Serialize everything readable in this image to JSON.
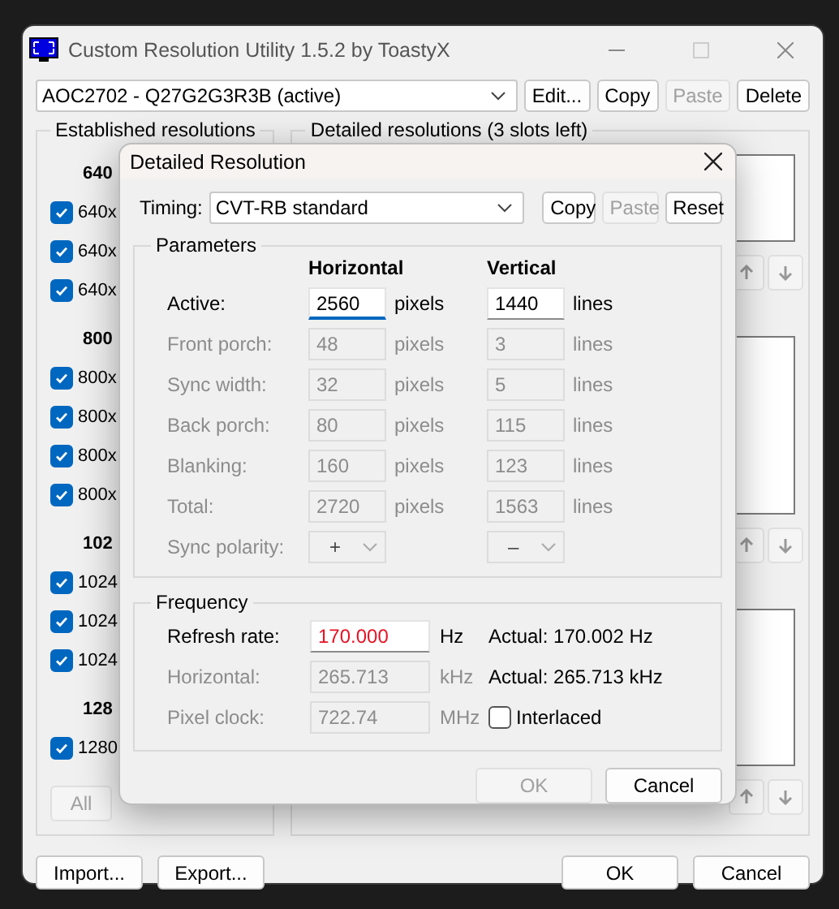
{
  "window": {
    "title": "Custom Resolution Utility 1.5.2 by ToastyX",
    "device": "AOC2702 - Q27G2G3R3B (active)",
    "buttons": [
      {
        "label": "Edit...",
        "disabled": false
      },
      {
        "label": "Copy",
        "disabled": false
      },
      {
        "label": "Paste",
        "disabled": true
      },
      {
        "label": "Delete",
        "disabled": false
      }
    ]
  },
  "established": {
    "title": "Established resolutions",
    "groups": [
      {
        "header": "640",
        "items": [
          {
            "label": "640x",
            "checked": true
          },
          {
            "label": "640x",
            "checked": true
          },
          {
            "label": "640x",
            "checked": true
          }
        ]
      },
      {
        "header": "800",
        "items": [
          {
            "label": "800x",
            "checked": true
          },
          {
            "label": "800x",
            "checked": true
          },
          {
            "label": "800x",
            "checked": true
          },
          {
            "label": "800x",
            "checked": true
          }
        ]
      },
      {
        "header": "102",
        "items": [
          {
            "label": "1024",
            "checked": true
          },
          {
            "label": "1024",
            "checked": true
          },
          {
            "label": "1024",
            "checked": true
          }
        ]
      },
      {
        "header": "128",
        "items": [
          {
            "label": "1280",
            "checked": true
          }
        ]
      }
    ],
    "button": "All"
  },
  "detailed": {
    "title": "Detailed resolutions (3 slots left)"
  },
  "footer": {
    "left": [
      "Import...",
      "Export..."
    ],
    "right": [
      "OK",
      "Cancel"
    ]
  },
  "dialog": {
    "title": "Detailed Resolution",
    "timing_label": "Timing:",
    "timing": "CVT-RB standard",
    "buttons": [
      {
        "label": "Copy",
        "disabled": false
      },
      {
        "label": "Paste",
        "disabled": true
      },
      {
        "label": "Reset",
        "disabled": false
      }
    ],
    "parameters": {
      "title": "Parameters",
      "columns": [
        "Horizontal",
        "Vertical"
      ],
      "rows": [
        {
          "kind": "field",
          "label": "Active:",
          "disabled": false,
          "h": {
            "value": "2560",
            "unit": "pixels",
            "focused": true
          },
          "v": {
            "value": "1440",
            "unit": "lines",
            "focused": false
          }
        },
        {
          "kind": "field",
          "label": "Front porch:",
          "disabled": true,
          "h": {
            "value": "48",
            "unit": "pixels",
            "focused": false
          },
          "v": {
            "value": "3",
            "unit": "lines",
            "focused": false
          }
        },
        {
          "kind": "field",
          "label": "Sync width:",
          "disabled": true,
          "h": {
            "value": "32",
            "unit": "pixels",
            "focused": false
          },
          "v": {
            "value": "5",
            "unit": "lines",
            "focused": false
          }
        },
        {
          "kind": "field",
          "label": "Back porch:",
          "disabled": true,
          "h": {
            "value": "80",
            "unit": "pixels",
            "focused": false
          },
          "v": {
            "value": "115",
            "unit": "lines",
            "focused": false
          }
        },
        {
          "kind": "field",
          "label": "Blanking:",
          "disabled": true,
          "h": {
            "value": "160",
            "unit": "pixels",
            "focused": false
          },
          "v": {
            "value": "123",
            "unit": "lines",
            "focused": false
          }
        },
        {
          "kind": "field",
          "label": "Total:",
          "disabled": true,
          "h": {
            "value": "2720",
            "unit": "pixels",
            "focused": false
          },
          "v": {
            "value": "1563",
            "unit": "lines",
            "focused": false
          }
        },
        {
          "kind": "select",
          "label": "Sync polarity:",
          "disabled": true,
          "h": {
            "value": "+"
          },
          "v": {
            "value": "–"
          }
        }
      ]
    },
    "frequency": {
      "title": "Frequency",
      "rows": [
        {
          "kind": "actual",
          "label": "Refresh rate:",
          "disabled": false,
          "invalid": true,
          "value": "170.000",
          "unit": "Hz",
          "actual": "Actual: 170.002 Hz"
        },
        {
          "kind": "actual",
          "label": "Horizontal:",
          "disabled": true,
          "invalid": false,
          "value": "265.713",
          "unit": "kHz",
          "actual": "Actual: 265.713 kHz"
        },
        {
          "kind": "checkbox",
          "label": "Pixel clock:",
          "disabled": true,
          "invalid": false,
          "value": "722.74",
          "unit": "MHz",
          "check_label": "Interlaced",
          "checked": false
        }
      ]
    },
    "ok": {
      "label": "OK",
      "disabled": true
    },
    "cancel": {
      "label": "Cancel",
      "disabled": false
    }
  }
}
